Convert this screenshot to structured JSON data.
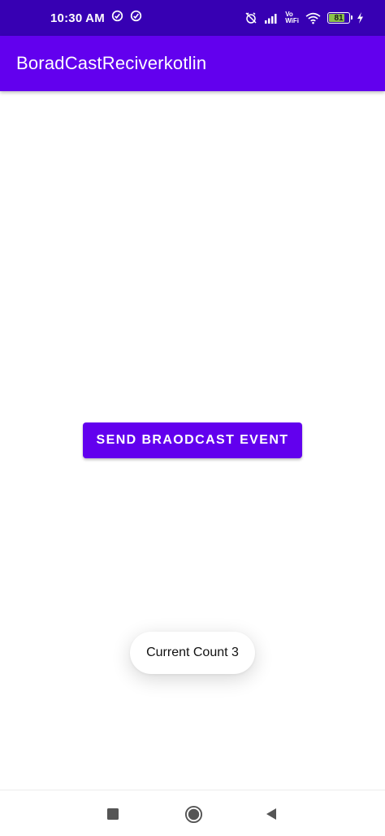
{
  "status_bar": {
    "time": "10:30 AM",
    "battery_level": "81",
    "battery_fraction": 0.81,
    "vowifi_top": "Vo",
    "vowifi_bottom": "WiFi",
    "icons": [
      "sync-icon",
      "sync-icon",
      "alarm-off-icon",
      "signal-icon",
      "wifi-icon",
      "battery-icon",
      "charging-icon"
    ]
  },
  "app_bar": {
    "title": "BoradCastReciverkotlin",
    "color": "#6200EE",
    "status_color": "#3700B3"
  },
  "main": {
    "send_button_label": "SEND BRAODCAST EVENT"
  },
  "toast": {
    "message": "Current Count 3"
  },
  "nav_bar": {
    "icons": [
      "recent-apps-icon",
      "home-icon",
      "back-icon"
    ]
  }
}
